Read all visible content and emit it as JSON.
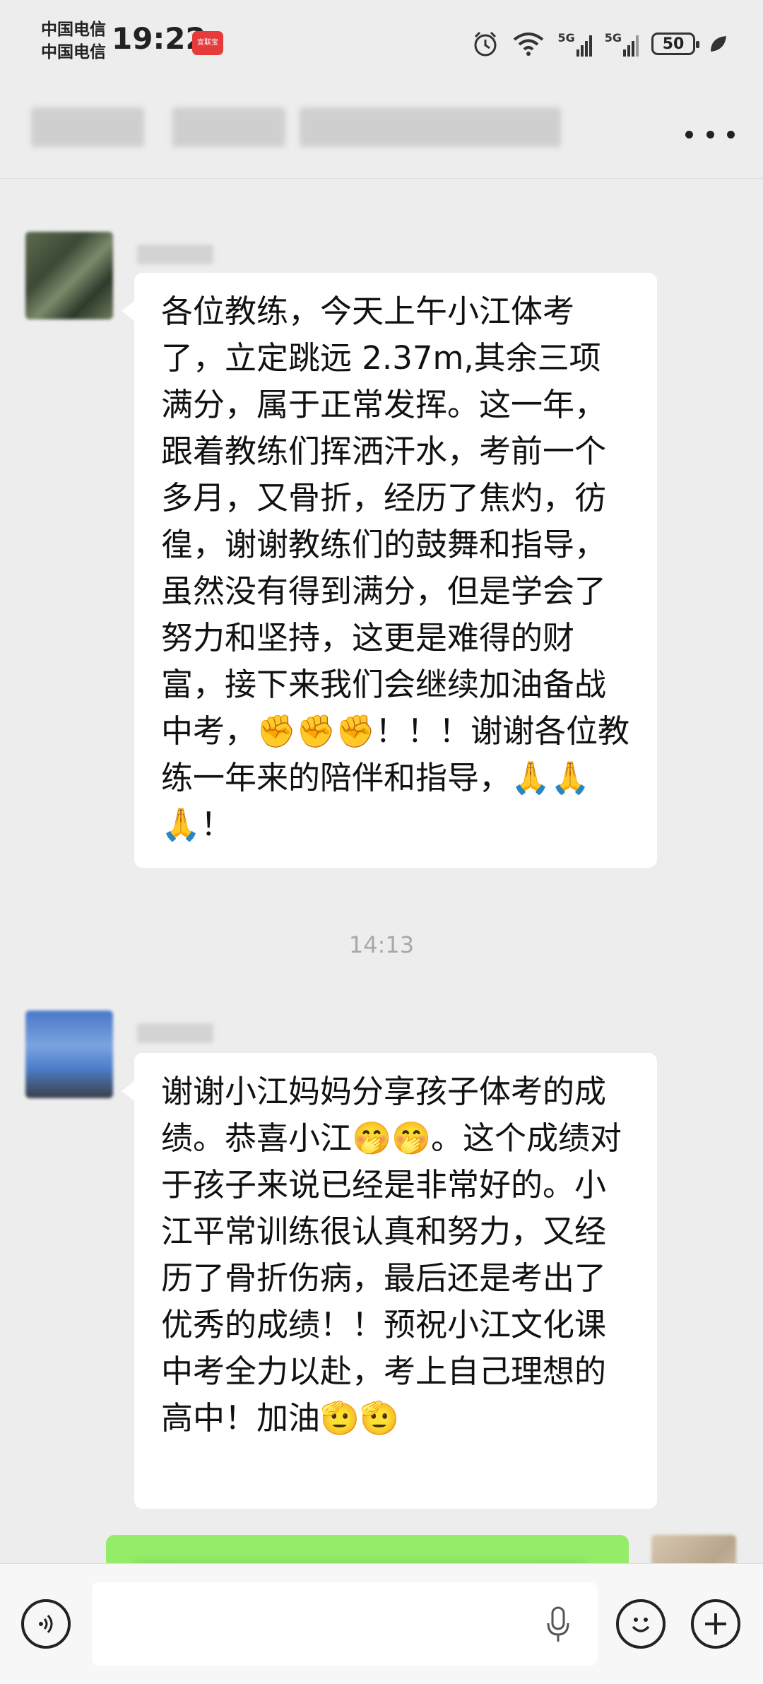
{
  "status_bar": {
    "carrier_1": "中国电信",
    "carrier_2": "中国电信",
    "time": "19:22",
    "app_badge": "宜联宝",
    "signal_1": "5G",
    "signal_2": "5G",
    "battery": "50"
  },
  "chat": {
    "messages": [
      {
        "text": "各位教练，今天上午小江体考了，立定跳远 2.37m,其余三项满分，属于正常发挥。这一年，跟着教练们挥洒汗水，考前一个多月，又骨折，经历了焦灼，彷徨，谢谢教练们的鼓舞和指导，虽然没有得到满分，但是学会了努力和坚持，这更是难得的财富，接下来我们会继续加油备战中考，✊✊✊！！！谢谢各位教练一年来的陪伴和指导，🙏🙏🙏！"
      },
      {
        "text": "谢谢小江妈妈分享孩子体考的成绩。恭喜小江🤭🤭。这个成绩对于孩子来说已经是非常好的。小江平常训练很认真和努力，又经历了骨折伤病，最后还是考出了优秀的成绩！！预祝小江文化课中考全力以赴，考上自己理想的高中！加油🫡🫡"
      }
    ],
    "timestamp": "14:13"
  },
  "colors": {
    "background": "#ededed",
    "bubble_incoming": "#ffffff",
    "bubble_outgoing": "#95ec69"
  }
}
